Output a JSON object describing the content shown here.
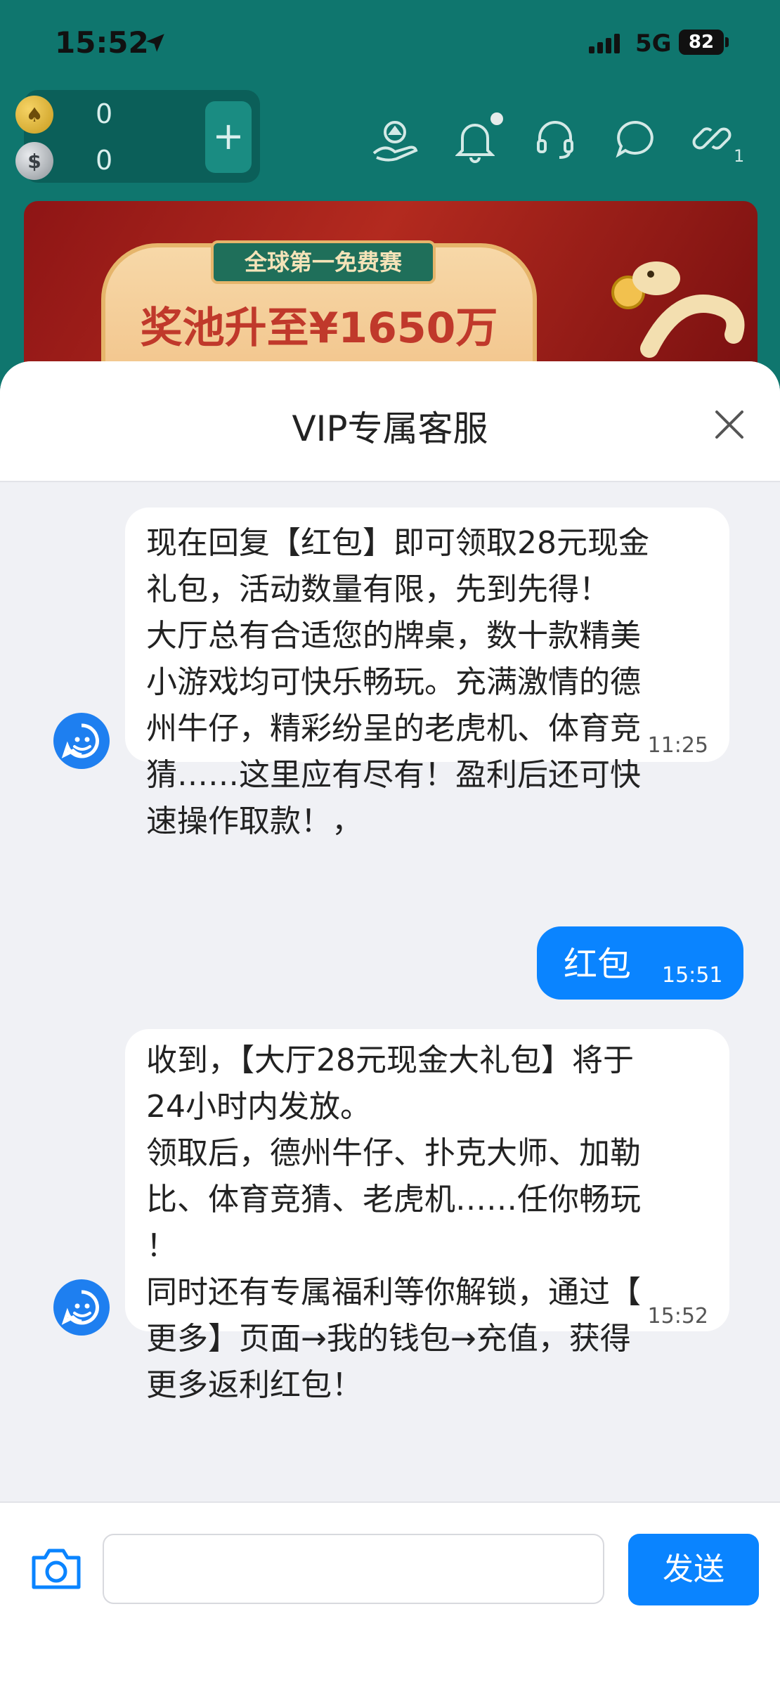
{
  "status_bar": {
    "time": "15:52",
    "network": "5G",
    "battery": "82"
  },
  "wallet": {
    "gold_value": "0",
    "cash_value": "0",
    "add_label": "+"
  },
  "header_icons": {
    "link_count": "1"
  },
  "banner": {
    "ribbon": "全球第一免费赛",
    "title": "奖池升至¥1650万"
  },
  "chat": {
    "title": "VIP专属客服",
    "messages": [
      {
        "sender": "agent",
        "text": "现在回复【红包】即可领取28元现金\n礼包，活动数量有限，先到先得！\n大厅总有合适您的牌桌，数十款精美\n小游戏均可快乐畅玩。充满激情的德\n州牛仔，精彩纷呈的老虎机、体育竞\n猜……这里应有尽有！盈利后还可快\n速操作取款！，",
        "time": "11:25"
      },
      {
        "sender": "me",
        "text": "红包",
        "time": "15:51"
      },
      {
        "sender": "agent",
        "text": "收到，【大厅28元现金大礼包】将于\n24小时内发放。\n领取后，德州牛仔、扑克大师、加勒\n比、体育竞猜、老虎机……任你畅玩\n！\n同时还有专属福利等你解锁，通过【\n更多】页面→我的钱包→充值，获得\n更多返利红包！",
        "time": "15:52"
      }
    ]
  },
  "composer": {
    "input_value": "",
    "send_label": "发送"
  },
  "colors": {
    "teal_bg": "#0f766e",
    "accent_blue": "#0a84ff",
    "sheet_bg": "#f0f1f5"
  }
}
